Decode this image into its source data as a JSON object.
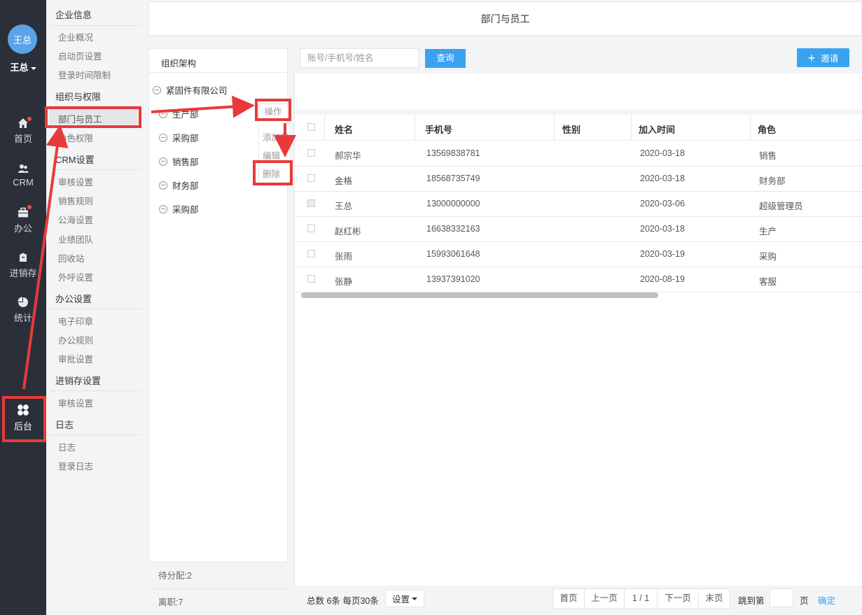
{
  "nav": {
    "avatar_text": "王总",
    "user_name": "王总",
    "items": [
      {
        "label": "首页",
        "icon": "home-icon"
      },
      {
        "label": "CRM",
        "icon": "users-icon"
      },
      {
        "label": "办公",
        "icon": "briefcase-icon"
      },
      {
        "label": "进销存",
        "icon": "box-icon"
      },
      {
        "label": "统计",
        "icon": "pie-chart-icon"
      },
      {
        "label": "后台",
        "icon": "clover-icon"
      }
    ]
  },
  "menu": {
    "sections": [
      {
        "title": "企业信息",
        "items": [
          "企业概况",
          "启动页设置",
          "登录时间限制"
        ]
      },
      {
        "title": "组织与权限",
        "items": [
          "部门与员工",
          "角色权限"
        ]
      },
      {
        "title": "CRM设置",
        "items": [
          "审核设置",
          "销售规则",
          "公海设置",
          "业绩团队",
          "回收站",
          "外呼设置"
        ]
      },
      {
        "title": "办公设置",
        "items": [
          "电子印章",
          "办公规则",
          "审批设置"
        ]
      },
      {
        "title": "进销存设置",
        "items": [
          "审核设置"
        ]
      },
      {
        "title": "日志",
        "items": [
          "日志",
          "登录日志"
        ]
      }
    ]
  },
  "header": {
    "title": "部门与员工"
  },
  "org": {
    "title": "组织架构",
    "root": "紧固件有限公司",
    "departments": [
      "生产部",
      "采购部",
      "销售部",
      "财务部",
      "采购部"
    ],
    "ops_label": "操作",
    "ops_menu": [
      "添加部",
      "编辑",
      "删除"
    ],
    "unassigned": "待分配:2",
    "resigned": "离职:7"
  },
  "search": {
    "placeholder": "账号/手机号/姓名",
    "query_label": "查询",
    "invite_label": "邀请"
  },
  "table": {
    "columns": [
      "姓名",
      "手机号",
      "性别",
      "加入时间",
      "角色"
    ],
    "rows": [
      {
        "name": "郝宗华",
        "phone": "13569838781",
        "gender": "",
        "joined": "2020-03-18",
        "role": "销售"
      },
      {
        "name": "金格",
        "phone": "18568735749",
        "gender": "",
        "joined": "2020-03-18",
        "role": "财务部"
      },
      {
        "name": "王总",
        "phone": "13000000000",
        "gender": "",
        "joined": "2020-03-06",
        "role": "超级管理员"
      },
      {
        "name": "赵红彬",
        "phone": "16638332163",
        "gender": "",
        "joined": "2020-03-18",
        "role": "生产"
      },
      {
        "name": "张雨",
        "phone": "15993061648",
        "gender": "",
        "joined": "2020-03-19",
        "role": "采购"
      },
      {
        "name": "张静",
        "phone": "13937391020",
        "gender": "",
        "joined": "2020-08-19",
        "role": "客服"
      }
    ]
  },
  "pager": {
    "summary": "总数 6条 每页30条",
    "settings": "设置",
    "first": "首页",
    "prev": "上一页",
    "current": "1 / 1",
    "next": "下一页",
    "last": "末页",
    "jump_prefix": "跳到第",
    "jump_suffix": "页",
    "confirm": "确定"
  },
  "colors": {
    "accent": "#3aa3f0",
    "nav_bg": "#2b2f3a",
    "annotation": "#e83a3a"
  }
}
